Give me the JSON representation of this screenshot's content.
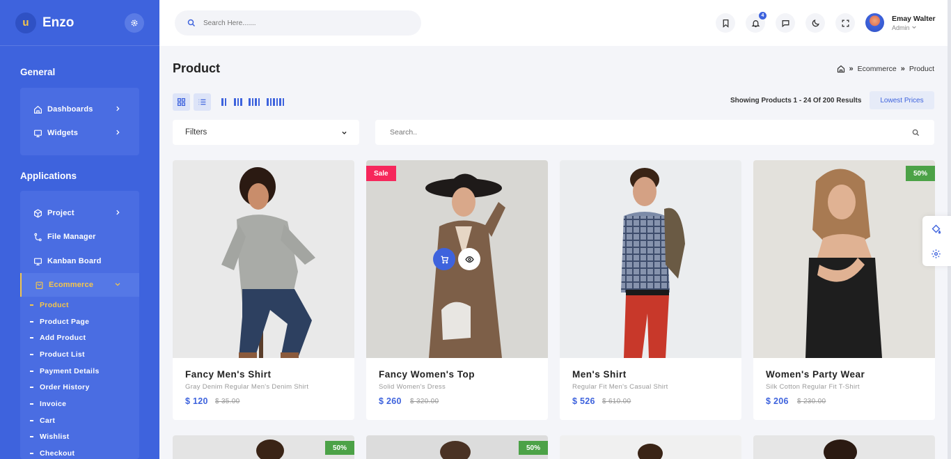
{
  "brand": {
    "name": "Enzo",
    "logo_letter": "u"
  },
  "sidebar": {
    "general_title": "General",
    "general_items": [
      {
        "label": "Dashboards",
        "icon": "home-icon"
      },
      {
        "label": "Widgets",
        "icon": "monitor-icon"
      }
    ],
    "applications_title": "Applications",
    "app_items": [
      {
        "label": "Project",
        "icon": "cube-icon"
      },
      {
        "label": "File Manager",
        "icon": "git-icon"
      },
      {
        "label": "Kanban Board",
        "icon": "monitor-icon"
      },
      {
        "label": "Ecommerce",
        "icon": "bag-icon",
        "active": true
      }
    ],
    "sub_items": [
      "Product",
      "Product Page",
      "Add Product",
      "Product List",
      "Payment Details",
      "Order History",
      "Invoice",
      "Cart",
      "Wishlist",
      "Checkout"
    ],
    "active_sub": "Product"
  },
  "header": {
    "search_placeholder": "Search Here.......",
    "notification_count": "4",
    "user_name": "Emay Walter",
    "user_role": "Admin"
  },
  "page": {
    "title": "Product",
    "breadcrumb": [
      "Ecommerce",
      "Product"
    ],
    "showing": "Showing Products 1 - 24 Of 200 Results",
    "sort_label": "Lowest Prices",
    "filters_label": "Filters",
    "search_placeholder": "Search.."
  },
  "products": [
    {
      "name": "Fancy Men's Shirt",
      "desc": "Gray Denim Regular Men's Denim Shirt",
      "price": "$ 120",
      "old_price": "$ 35.00",
      "tag": ""
    },
    {
      "name": "Fancy Women's Top",
      "desc": "Solid Women's Dress",
      "price": "$ 260",
      "old_price": "$ 320.00",
      "tag": "Sale"
    },
    {
      "name": "Men's Shirt",
      "desc": "Regular Fit Men's Casual Shirt",
      "price": "$ 526",
      "old_price": "$ 610.00",
      "tag": ""
    },
    {
      "name": "Women's Party Wear",
      "desc": "Silk Cotton Regular Fit T-Shirt",
      "price": "$ 206",
      "old_price": "$ 230.00",
      "tag": "50%"
    }
  ],
  "second_row_tags": [
    "50%",
    "50%",
    "",
    ""
  ],
  "colors": {
    "primary": "#3e63dd",
    "accent": "#f5c64b",
    "sale": "#f6275b",
    "discount": "#4ca247"
  }
}
